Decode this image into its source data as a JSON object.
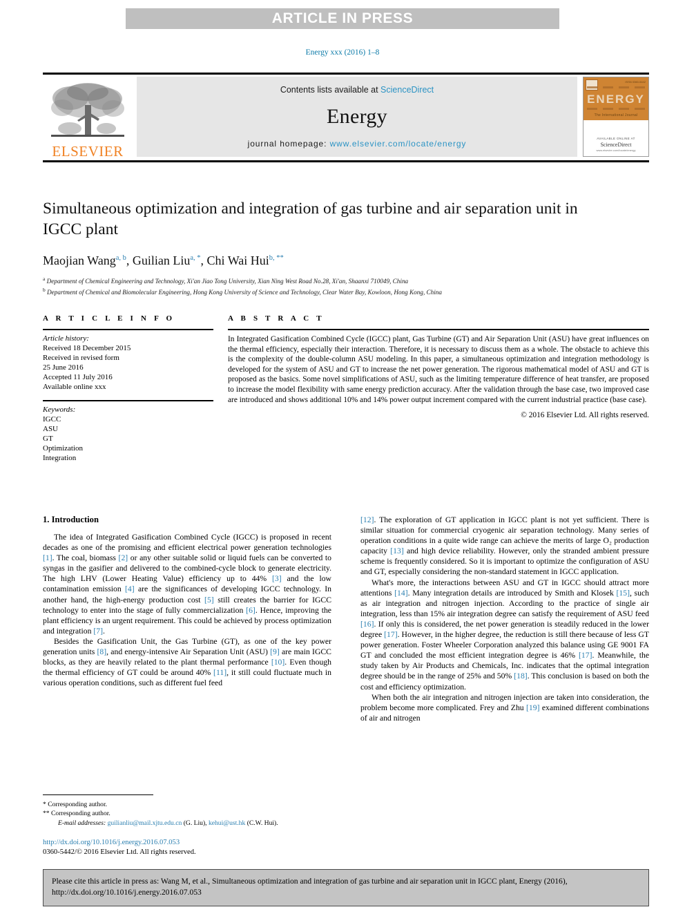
{
  "banner": {
    "text": "ARTICLE IN PRESS"
  },
  "running_head": {
    "text": "Energy xxx (2016) 1–8"
  },
  "journal_header": {
    "publisher": "ELSEVIER",
    "contents_prefix": "Contents lists available at ",
    "contents_link": "ScienceDirect",
    "journal_name": "Energy",
    "homepage_prefix": "journal homepage: ",
    "homepage_url": "www.elsevier.com/locate/energy",
    "cover_title": "ENERGY",
    "cover_subtitle": "The International Journal",
    "cover_footer_small": "AVAILABLE ONLINE AT",
    "cover_footer_brand": "ScienceDirect",
    "cover_footer_tiny": "www.elsevier.com/locate/energy",
    "cover_corner": "ISSN 0360-5442"
  },
  "article": {
    "title": "Simultaneous optimization and integration of gas turbine and air separation unit in IGCC plant",
    "authors": [
      {
        "name": "Maojian Wang",
        "marks": "a, b",
        "sep": ", "
      },
      {
        "name": "Guilian Liu",
        "marks": "a, *",
        "sep": ", "
      },
      {
        "name": "Chi Wai Hui",
        "marks": "b, **",
        "sep": ""
      }
    ],
    "affiliations": [
      {
        "mark": "a",
        "text": "Department of Chemical Engineering and Technology, Xi'an Jiao Tong University, Xian Ning West Road No.28, Xi'an, Shaanxi 710049, China"
      },
      {
        "mark": "b",
        "text": "Department of Chemical and Biomolecular Engineering, Hong Kong University of Science and Technology, Clear Water Bay, Kowloon, Hong Kong, China"
      }
    ]
  },
  "article_info": {
    "heading": "A R T I C L E   I N F O",
    "history_label": "Article history:",
    "history_lines": [
      "Received 18 December 2015",
      "Received in revised form",
      "25 June 2016",
      "Accepted 11 July 2016",
      "Available online xxx"
    ],
    "keywords_label": "Keywords:",
    "keywords": [
      "IGCC",
      "ASU",
      "GT",
      "Optimization",
      "Integration"
    ]
  },
  "abstract": {
    "heading": "A B S T R A C T",
    "text": "In Integrated Gasification Combined Cycle (IGCC) plant, Gas Turbine (GT) and Air Separation Unit (ASU) have great influences on the thermal efficiency, especially their interaction. Therefore, it is necessary to discuss them as a whole. The obstacle to achieve this is the complexity of the double-column ASU modeling. In this paper, a simultaneous optimization and integration methodology is developed for the system of ASU and GT to increase the net power generation. The rigorous mathematical model of ASU and GT is proposed as the basics. Some novel simplifications of ASU, such as the limiting temperature difference of heat transfer, are proposed to increase the model flexibility with same energy prediction accuracy. After the validation through the base case, two improved case are introduced and shows additional 10% and 14% power output increment compared with the current industrial practice (base case).",
    "rights": "© 2016 Elsevier Ltd. All rights reserved."
  },
  "introduction": {
    "heading": "1. Introduction",
    "left_paragraphs": [
      "The idea of Integrated Gasification Combined Cycle (IGCC) is proposed in recent decades as one of the promising and efficient electrical power generation technologies [1]. The coal, biomass [2] or any other suitable solid or liquid fuels can be converted to syngas in the gasifier and delivered to the combined-cycle block to generate electricity. The high LHV (Lower Heating Value) efficiency up to 44% [3] and the low contamination emission [4] are the significances of developing IGCC technology. In another hand, the high-energy production cost [5] still creates the barrier for IGCC technology to enter into the stage of fully commercialization [6]. Hence, improving the plant efficiency is an urgent requirement. This could be achieved by process optimization and integration [7].",
      "Besides the Gasification Unit, the Gas Turbine (GT), as one of the key power generation units [8], and energy-intensive Air Separation Unit (ASU) [9] are main IGCC blocks, as they are heavily related to the plant thermal performance [10]. Even though the thermal efficiency of GT could be around 40% [11], it still could fluctuate much in various operation conditions, such as different fuel feed"
    ],
    "right_paragraphs": [
      "[12]. The exploration of GT application in IGCC plant is not yet sufficient. There is similar situation for commercial cryogenic air separation technology. Many series of operation conditions in a quite wide range can achieve the merits of large O₂ production capacity [13] and high device reliability. However, only the stranded ambient pressure scheme is frequently considered. So it is important to optimize the configuration of ASU and GT, especially considering the non-standard statement in IGCC application.",
      "What's more, the interactions between ASU and GT in IGCC should attract more attentions [14]. Many integration details are introduced by Smith and Klosek [15], such as air integration and nitrogen injection. According to the practice of single air integration, less than 15% air integration degree can satisfy the requirement of ASU feed [16]. If only this is considered, the net power generation is steadily reduced in the lower degree [17]. However, in the higher degree, the reduction is still there because of less GT power generation. Foster Wheeler Corporation analyzed this balance using GE 9001 FA GT and concluded the most efficient integration degree is 46% [17]. Meanwhile, the study taken by Air Products and Chemicals, Inc. indicates that the optimal integration degree should be in the range of 25% and 50% [18]. This conclusion is based on both the cost and efficiency optimization.",
      "When both the air integration and nitrogen injection are taken into consideration, the problem become more complicated. Frey and Zhu [19] examined different combinations of air and nitrogen"
    ]
  },
  "footnotes": {
    "line1_mark": "*",
    "line1": "Corresponding author.",
    "line2_mark": "**",
    "line2": "Corresponding author.",
    "email_label": "E-mail addresses:",
    "email1": "guilianliu@mail.xjtu.edu.cn",
    "email1_owner": "(G. Liu)",
    "email2": "kehui@ust.hk",
    "email2_owner": "(C.W. Hui)."
  },
  "doi_block": {
    "doi": "http://dx.doi.org/10.1016/j.energy.2016.07.053",
    "issn_line": "0360-5442/© 2016 Elsevier Ltd. All rights reserved."
  },
  "cite_box": {
    "text": "Please cite this article in press as: Wang M, et al., Simultaneous optimization and integration of gas turbine and air separation unit in IGCC plant, Energy (2016), http://dx.doi.org/10.1016/j.energy.2016.07.053"
  },
  "colors": {
    "link": "#2b7fb0",
    "banner_bg": "#bfbfbf",
    "elsevier_orange": "#f08224",
    "cover_orange": "#cf8433",
    "cite_bg": "#c4c4c4"
  }
}
